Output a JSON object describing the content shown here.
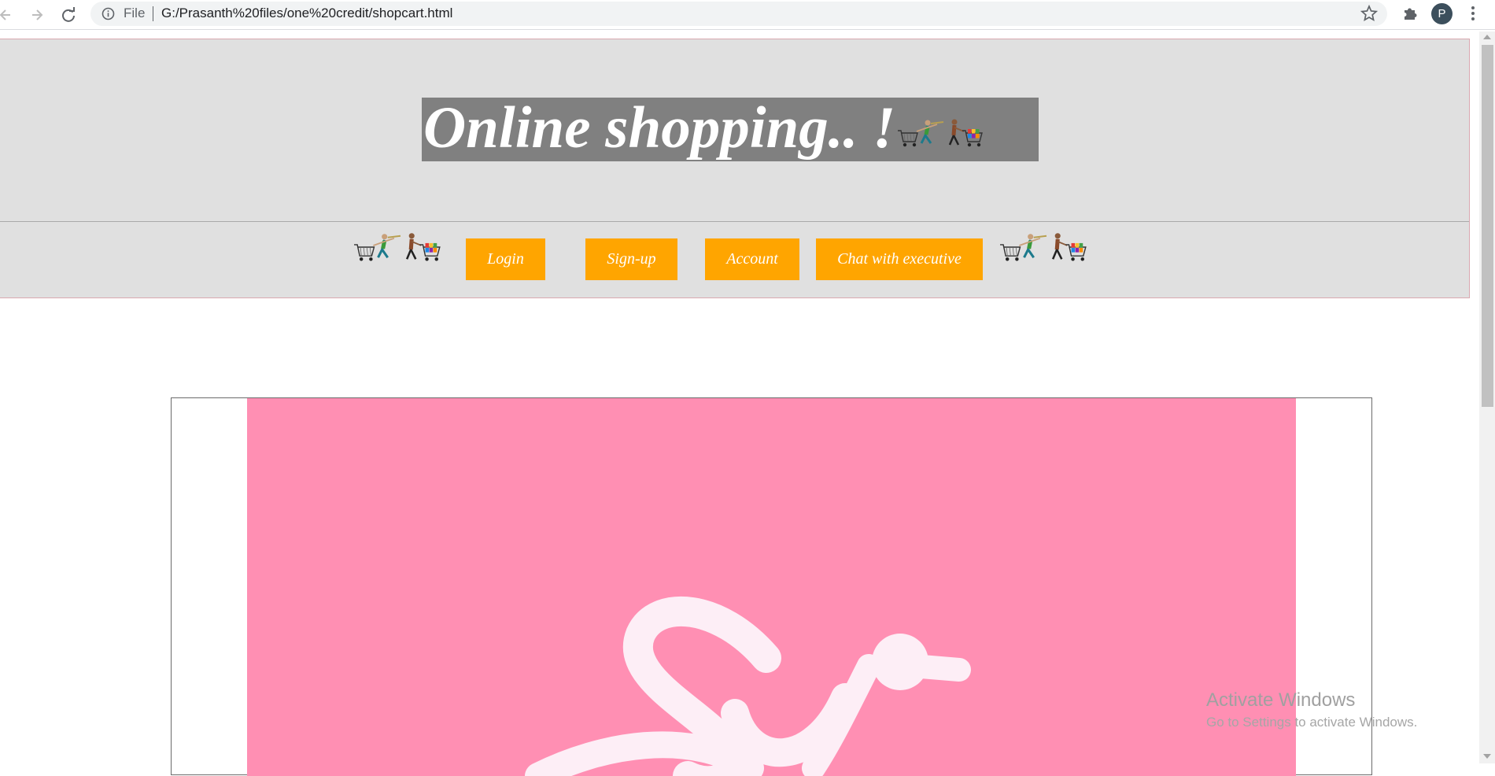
{
  "browser": {
    "scheme_label": "File",
    "url": "G:/Prasanth%20files/one%20credit/shopcart.html",
    "profile_initial": "P"
  },
  "page": {
    "title": "Online shopping.. !",
    "menu": [
      {
        "label": "Login"
      },
      {
        "label": "Sign-up"
      },
      {
        "label": "Account"
      },
      {
        "label": "Chat with executive"
      }
    ],
    "colors": {
      "header_bg": "#e0e0e0",
      "title_bg": "#808080",
      "button_bg": "#ffa500",
      "banner_bg": "#ff8fb3"
    }
  },
  "os_overlay": {
    "title": "Activate Windows",
    "subtitle": "Go to Settings to activate Windows."
  },
  "icons": [
    "back-arrow-icon",
    "forward-arrow-icon",
    "reload-icon",
    "info-icon",
    "star-icon",
    "puzzle-icon",
    "kebab-menu-icon",
    "shopper-cart-icon"
  ]
}
